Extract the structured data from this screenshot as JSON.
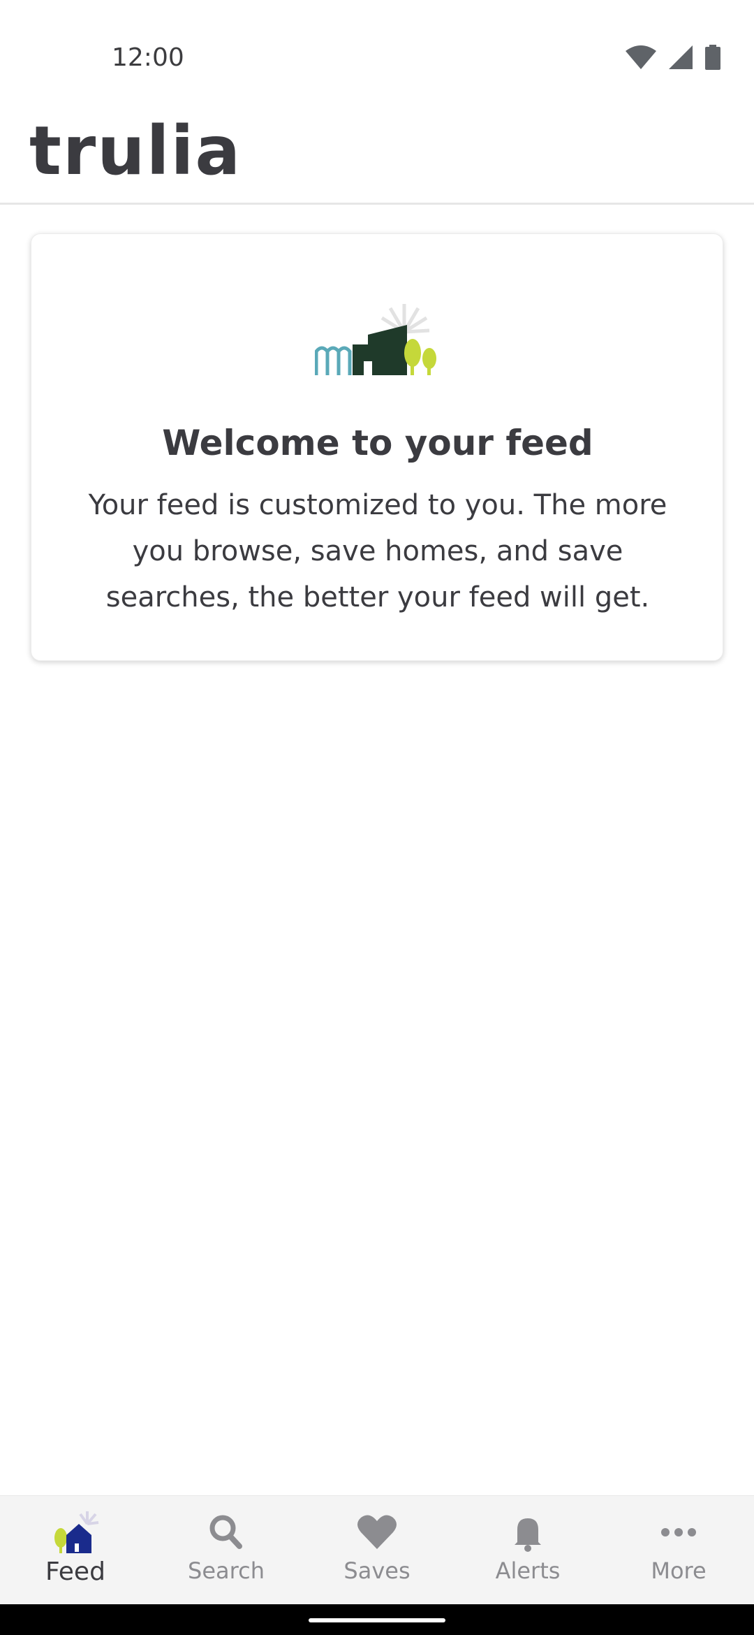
{
  "status_bar": {
    "time": "12:00",
    "icons": [
      "wifi-icon",
      "cellular-icon",
      "battery-icon"
    ]
  },
  "header": {
    "brand": "trulia"
  },
  "welcome_card": {
    "illustration": "feed-neighborhood-illustration",
    "title": "Welcome to your feed",
    "body": "Your feed is customized to you. The more you browse, save homes, and save searches, the better your feed will get."
  },
  "bottom_nav": {
    "items": [
      {
        "label": "Feed",
        "icon": "feed-house-icon",
        "active": true
      },
      {
        "label": "Search",
        "icon": "search-icon",
        "active": false
      },
      {
        "label": "Saves",
        "icon": "heart-icon",
        "active": false
      },
      {
        "label": "Alerts",
        "icon": "bell-icon",
        "active": false
      },
      {
        "label": "More",
        "icon": "more-dots-icon",
        "active": false
      }
    ]
  },
  "colors": {
    "text_primary": "#3b3b40",
    "nav_inactive": "#8c8c90",
    "nav_background": "#f4f4f4",
    "feed_house_blue": "#1a2b8c",
    "illustration_teal": "#5aa9b8",
    "illustration_dark_green": "#1f3a2a",
    "illustration_lime": "#c5d83a"
  }
}
